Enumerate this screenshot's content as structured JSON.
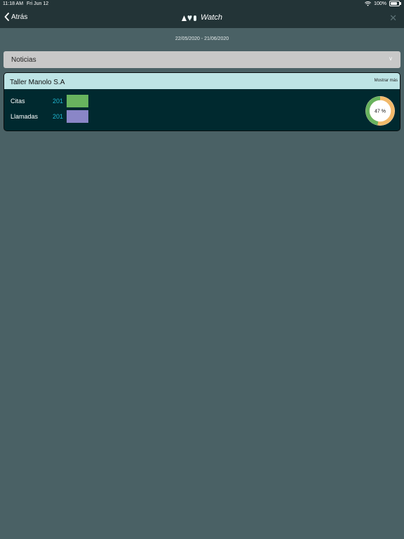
{
  "status_bar": {
    "time": "11:18 AM",
    "date": "Fri Jun 12",
    "battery": "100%"
  },
  "nav": {
    "back_label": "Atrás",
    "logo_text": "Watch",
    "close_icon": "close-icon"
  },
  "date_range": "22/05/2020 - 21/06/2020",
  "accordion": {
    "label": "Noticias",
    "chevron": "v"
  },
  "card": {
    "company": "Taller Manolo S.A",
    "more_label": "Mostrar más",
    "stats": [
      {
        "label": "Citas",
        "value": "201",
        "color": "#68b35e"
      },
      {
        "label": "Llamadas",
        "value": "201",
        "color": "#8a86c7"
      }
    ],
    "donut": {
      "percent_label": "47 %",
      "fraction": 0.47,
      "fill_color": "#68b35e",
      "track_color": "#f2b96a"
    }
  },
  "colors": {
    "background": "#4a6165",
    "navbar": "#233437",
    "card": "#00292f",
    "card_header": "#bde4e5",
    "accent_text": "#1fb7d1"
  }
}
